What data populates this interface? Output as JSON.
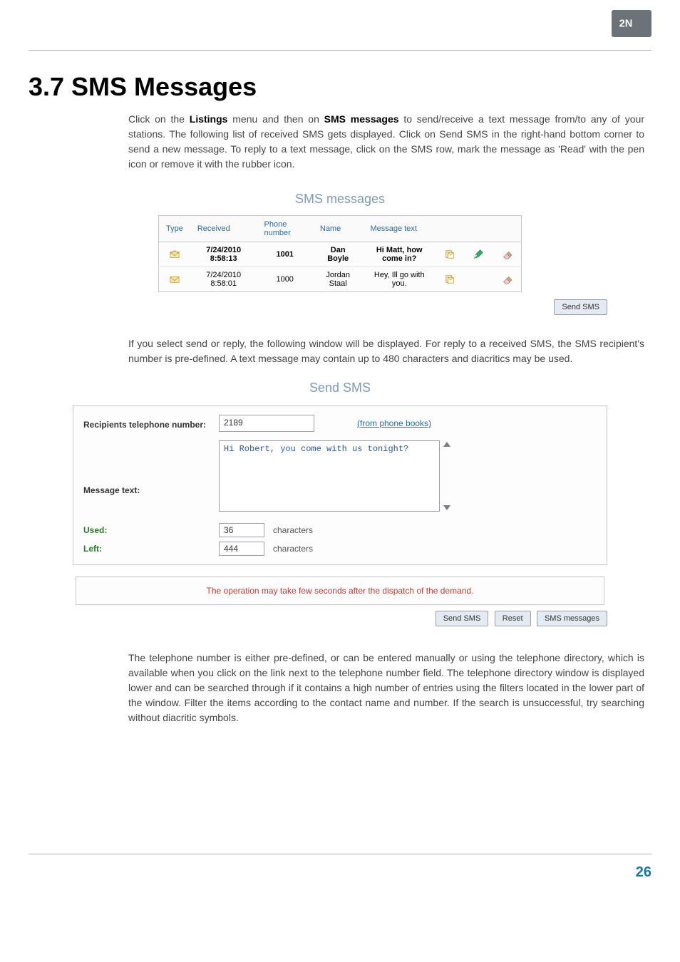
{
  "brand": "2N",
  "section_title": "3.7 SMS Messages",
  "para1_pre": "Click on the ",
  "para1_b1": "Listings",
  "para1_mid": " menu and then on ",
  "para1_b2": "SMS messages",
  "para1_post": " to send/receive a text message from/to any of your stations. The following list of received SMS gets displayed. Click on Send SMS in the right-hand bottom corner to send a new message. To reply to a text message, click on the SMS row, mark the message as 'Read' with the pen icon or remove it with the rubber icon.",
  "shot1_title": "SMS messages",
  "table1": {
    "headers": {
      "type": "Type",
      "received": "Received",
      "phone": "Phone number",
      "name": "Name",
      "text": "Message text"
    },
    "rows": [
      {
        "unread": true,
        "received": "7/24/2010 8:58:13",
        "phone": "1001",
        "name": "Dan Boyle",
        "text": "Hi Matt, how come in?",
        "pen": true
      },
      {
        "unread": false,
        "received": "7/24/2010 8:58:01",
        "phone": "1000",
        "name": "Jordan Staal",
        "text": "Hey, Ill go with you.",
        "pen": false
      }
    ]
  },
  "btn_send_sms": "Send SMS",
  "para2": "If you select send or reply, the following window will be displayed. For reply to a received SMS, the SMS recipient's number is pre-defined. A text message may contain up to 480 characters and diacritics may be used.",
  "shot2_title": "Send SMS",
  "form": {
    "recipients_label": "Recipients telephone number:",
    "recipients_value": "2189",
    "phone_books_link": "(from phone books)",
    "msg_label": "Message text:",
    "msg_value": "Hi Robert, you come with us tonight?",
    "used_label": "Used:",
    "used_value": "36",
    "left_label": "Left:",
    "left_value": "444",
    "chars_unit": "characters"
  },
  "warning": "The operation may take few seconds after the dispatch of the demand.",
  "action_buttons": {
    "send": "Send SMS",
    "reset": "Reset",
    "msgs": "SMS messages"
  },
  "para3": "The telephone number is either pre-defined, or can be entered manually or using the telephone directory, which is available when you click on the link next to the telephone number field. The telephone directory window is displayed lower and can be searched through if it contains a high number of entries using the filters located in the lower part of the window. Filter the items according to the contact name and number. If the search is unsuccessful, try searching without diacritic symbols.",
  "page_number": "26"
}
